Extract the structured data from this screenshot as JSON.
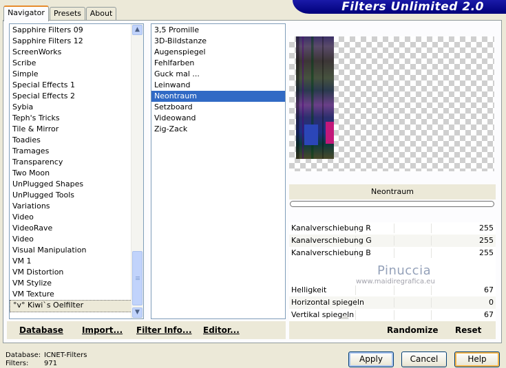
{
  "window": {
    "title": "Filters Unlimited 2.0"
  },
  "tabs": [
    {
      "label": "Navigator",
      "active": true
    },
    {
      "label": "Presets",
      "active": false
    },
    {
      "label": "About",
      "active": false
    }
  ],
  "categories": {
    "items": [
      "Sapphire Filters 09",
      "Sapphire Filters 12",
      "ScreenWorks",
      "Scribe",
      "Simple",
      "Special Effects 1",
      "Special Effects 2",
      "Sybia",
      "Teph's Tricks",
      "Tile & Mirror",
      "Toadies",
      "Tramages",
      "Transparency",
      "Two Moon",
      "UnPlugged Shapes",
      "UnPlugged Tools",
      "Variations",
      "Video",
      "VideoRave",
      "Video",
      "Visual Manipulation",
      "VM 1",
      "VM Distortion",
      "VM Stylize",
      "VM Texture",
      "°v° Kiwi`s Oelfilter"
    ],
    "selected_index": 25
  },
  "filters": {
    "items": [
      "3,5 Promille",
      "3D-Bildstanze",
      "Augenspiegel",
      "Fehlfarben",
      "Guck mal ...",
      "Leinwand",
      "Neontraum",
      "Setzboard",
      "Videowand",
      "Zig-Zack"
    ],
    "selected_index": 6
  },
  "left_toolbar": {
    "database": "Database",
    "import": "Import...",
    "filter_info": "Filter Info...",
    "editor": "Editor..."
  },
  "filter_name": "Neontraum",
  "progress_fraction": 0,
  "params": {
    "group1": [
      {
        "label": "Kanalverschiebung R",
        "value": "255"
      },
      {
        "label": "Kanalverschiebung G",
        "value": "255"
      },
      {
        "label": "Kanalverschiebung B",
        "value": "255"
      }
    ],
    "group2": [
      {
        "label": "Helligkeit",
        "value": "67"
      },
      {
        "label": "Horizontal spiegeln",
        "value": "0"
      },
      {
        "label": "Vertikal spiegeln",
        "value": "67"
      }
    ]
  },
  "watermark": {
    "name": "Pinuccia",
    "site": "www.maidiregrafica.eu"
  },
  "right_toolbar": {
    "randomize": "Randomize",
    "reset": "Reset"
  },
  "status": {
    "database_label": "Database:",
    "database_value": "ICNET-Filters",
    "filters_label": "Filters:",
    "filters_value": "971"
  },
  "buttons": {
    "apply": "Apply",
    "cancel": "Cancel",
    "help": "Help"
  },
  "colors": {
    "selection": "#316ac5",
    "banner": "#00007a",
    "tab_accent": "#e68b2c",
    "face": "#ece9d8"
  }
}
